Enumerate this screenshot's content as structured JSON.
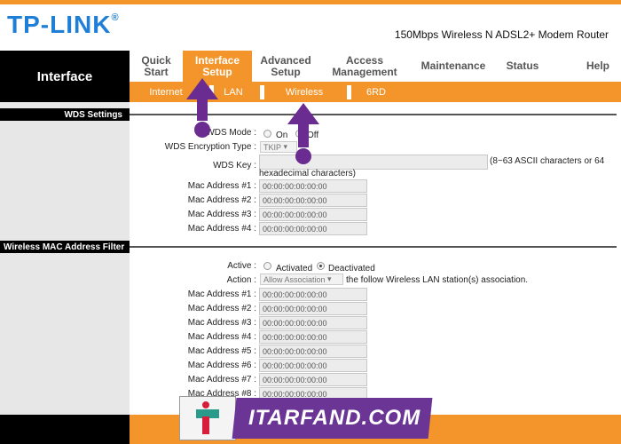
{
  "brand": {
    "logo": "TP-LINK",
    "reg": "®",
    "model": "150Mbps Wireless N ADSL2+ Modem Router"
  },
  "nav": {
    "section": "Interface",
    "items": [
      {
        "label1": "Quick",
        "label2": "Start"
      },
      {
        "label1": "Interface",
        "label2": "Setup"
      },
      {
        "label1": "Advanced",
        "label2": "Setup"
      },
      {
        "label1": "Access",
        "label2": "Management"
      },
      {
        "label1": "Maintenance",
        "label2": ""
      },
      {
        "label1": "Status",
        "label2": ""
      },
      {
        "label1": "Help",
        "label2": ""
      }
    ],
    "sub": [
      "Internet",
      "LAN",
      "Wireless",
      "6RD"
    ]
  },
  "wds": {
    "heading": "WDS Settings",
    "mode_label": "WDS Mode :",
    "on": "On",
    "off": "Off",
    "enc_label": "WDS Encryption Type :",
    "enc_value": "TKIP",
    "key_label": "WDS Key :",
    "key_hint": "(8~63 ASCII characters or 64",
    "key_hint2": "hexadecimal characters)",
    "mac_labels": [
      "Mac Address #1 :",
      "Mac Address #2 :",
      "Mac Address #3 :",
      "Mac Address #4 :"
    ],
    "mac_values": [
      "00:00:00:00:00:00",
      "00:00:00:00:00:00",
      "00:00:00:00:00:00",
      "00:00:00:00:00:00"
    ]
  },
  "macfilter": {
    "heading": "Wireless MAC Address Filter",
    "active_label": "Active :",
    "activated": "Activated",
    "deactivated": "Deactivated",
    "action_label": "Action :",
    "action_value": "Allow Association",
    "action_hint": "the follow Wireless LAN station(s) association.",
    "mac_labels": [
      "Mac Address #1 :",
      "Mac Address #2 :",
      "Mac Address #3 :",
      "Mac Address #4 :",
      "Mac Address #5 :",
      "Mac Address #6 :",
      "Mac Address #7 :",
      "Mac Address #8 :"
    ],
    "mac_values": [
      "00:00:00:00:00:00",
      "00:00:00:00:00:00",
      "00:00:00:00:00:00",
      "00:00:00:00:00:00",
      "00:00:00:00:00:00",
      "00:00:00:00:00:00",
      "00:00:00:00:00:00",
      "00:00:00:00:00:00"
    ]
  },
  "watermark": {
    "text": "ITARFAND.COM"
  },
  "colors": {
    "accent": "#f3952b",
    "logo": "#1f7fd6",
    "arrow": "#6a2c91"
  }
}
